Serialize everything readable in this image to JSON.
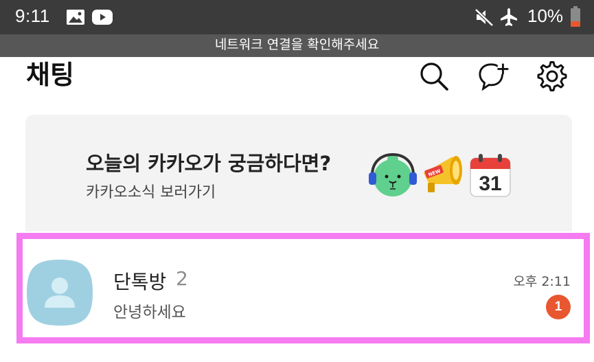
{
  "status_bar": {
    "time": "9:11",
    "left_icons": [
      "image-icon",
      "youtube-icon"
    ],
    "right_icons": [
      "mute-icon",
      "airplane-icon",
      "battery-icon"
    ],
    "battery": "10%"
  },
  "network_banner": {
    "text": "네트워크 연결을 확인해주세요"
  },
  "header": {
    "title": "채팅",
    "actions": [
      "search-icon",
      "new-chat-icon",
      "settings-icon"
    ]
  },
  "promo": {
    "title": "오늘의 카카오가 궁금하다면?",
    "subtitle": "카카오소식 보러가기",
    "emojis": [
      "character-headset-emoji",
      "megaphone-new-emoji",
      "calendar-emoji"
    ],
    "calendar_day": "31",
    "megaphone_label": "NEW"
  },
  "chat_list": [
    {
      "name": "단톡방",
      "member_count": "2",
      "preview": "안녕하세요",
      "time": "오후 2:11",
      "unread": "1"
    }
  ],
  "colors": {
    "status_bar": "#3b3b3b",
    "network_banner": "#575757",
    "promo_background": "#f3f3f3",
    "highlight": "#f57bf0",
    "avatar": "#9fd0e2",
    "unread_badge": "#e8572f",
    "battery_low": "#e8572f"
  }
}
